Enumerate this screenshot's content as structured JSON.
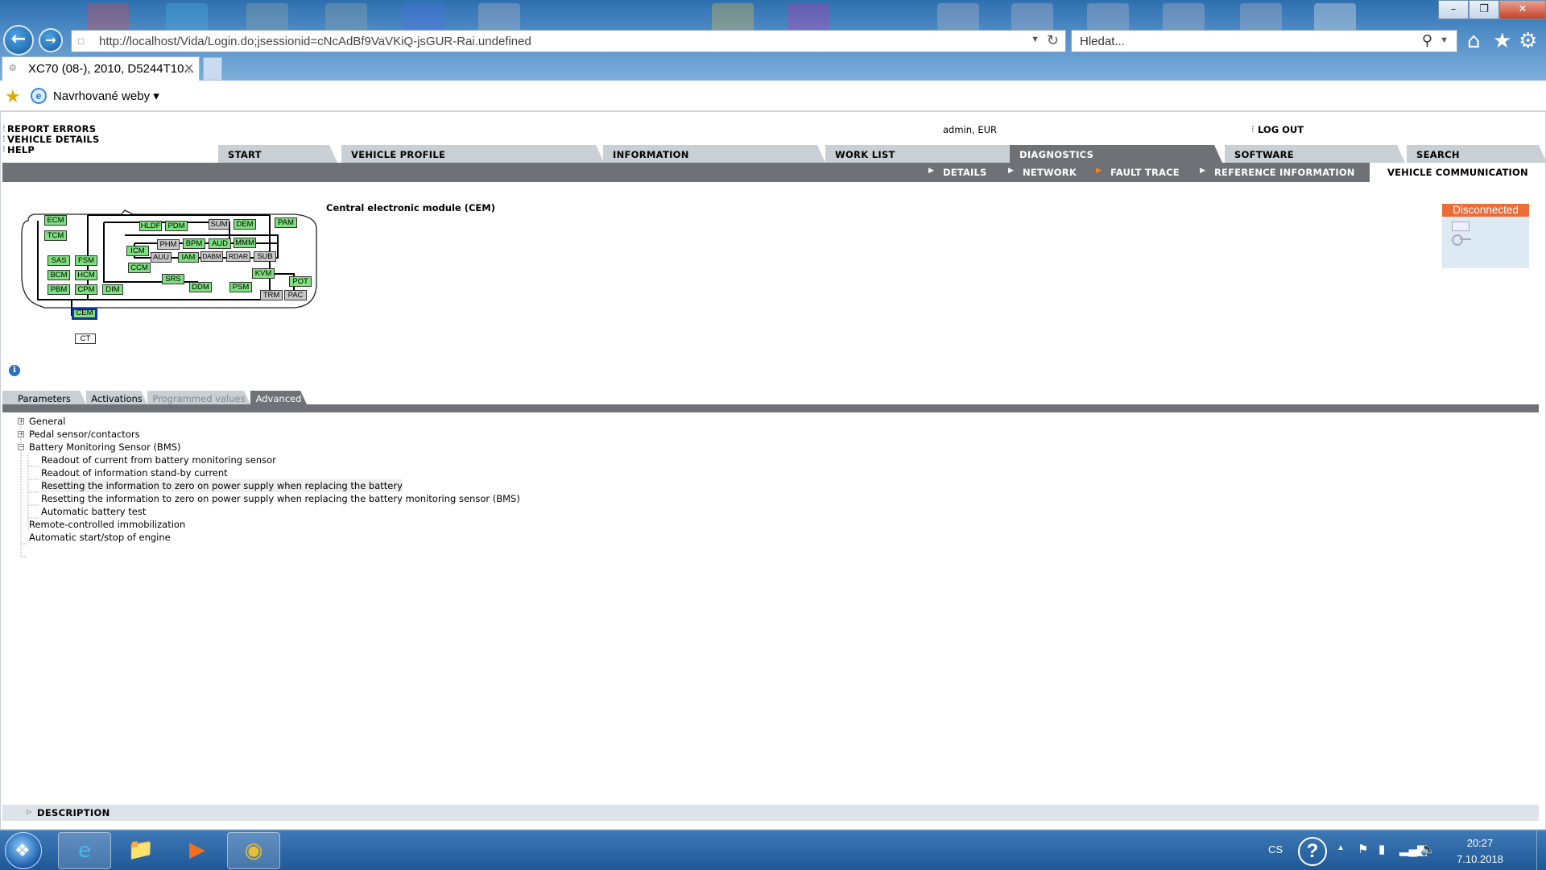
{
  "browser": {
    "url": "http://localhost/Vida/Login.do;jsessionid=cNcAdBf9VaVKiQ-jsGUR-Rai.undefined",
    "search_placeholder": "Hledat...",
    "tab_title": "XC70 (08-), 2010, D5244T10...",
    "favorites_label": "Navrhované weby"
  },
  "app": {
    "util_links": [
      "REPORT ERRORS",
      "VEHICLE DETAILS",
      "HELP"
    ],
    "user": "admin, EUR",
    "logout": "LOG OUT",
    "main_tabs": [
      "START",
      "VEHICLE PROFILE",
      "INFORMATION",
      "WORK LIST",
      "DIAGNOSTICS",
      "SOFTWARE",
      "SEARCH"
    ],
    "active_main_tab": "DIAGNOSTICS",
    "sub_tabs": [
      "DETAILS",
      "NETWORK",
      "FAULT TRACE",
      "REFERENCE INFORMATION",
      "VEHICLE COMMUNICATION"
    ],
    "active_sub_tab": "VEHICLE COMMUNICATION",
    "module_title": "Central electronic module (CEM)",
    "status": "Disconnected",
    "status_color": "#ee6c36",
    "ecus": [
      "ECM",
      "TCM",
      "SAS",
      "FSM",
      "BCM",
      "HCM",
      "PBM",
      "CPM",
      "DIM",
      "CEM",
      "CT",
      "HLDF",
      "PDM",
      "SUM",
      "DEM",
      "PAM",
      "PHM",
      "BPM",
      "AUD",
      "MMM",
      "ICM",
      "AUU",
      "IAM",
      "DABM",
      "RDAR",
      "SUB",
      "CCM",
      "SRS",
      "DDM",
      "PSM",
      "KVM",
      "POT",
      "TRM",
      "PAC"
    ],
    "content_tabs": [
      "Parameters",
      "Activations",
      "Programmed values",
      "Advanced"
    ],
    "active_content_tab": "Advanced",
    "tree": {
      "general": "General",
      "pedal": "Pedal sensor/contactors",
      "bms": "Battery Monitoring Sensor (BMS)",
      "bms_items": [
        "Readout of current from battery monitoring sensor",
        "Readout of information stand-by current",
        "Resetting the information to zero on power supply when replacing the battery",
        "Resetting the information to zero on power supply when replacing the battery monitoring sensor (BMS)",
        "Automatic battery test"
      ],
      "remote": "Remote-controlled immobilization",
      "startstop": "Automatic start/stop of engine"
    },
    "description": "DESCRIPTION"
  },
  "taskbar": {
    "lang": "CS",
    "time": "20:27",
    "date": "7.10.2018"
  }
}
